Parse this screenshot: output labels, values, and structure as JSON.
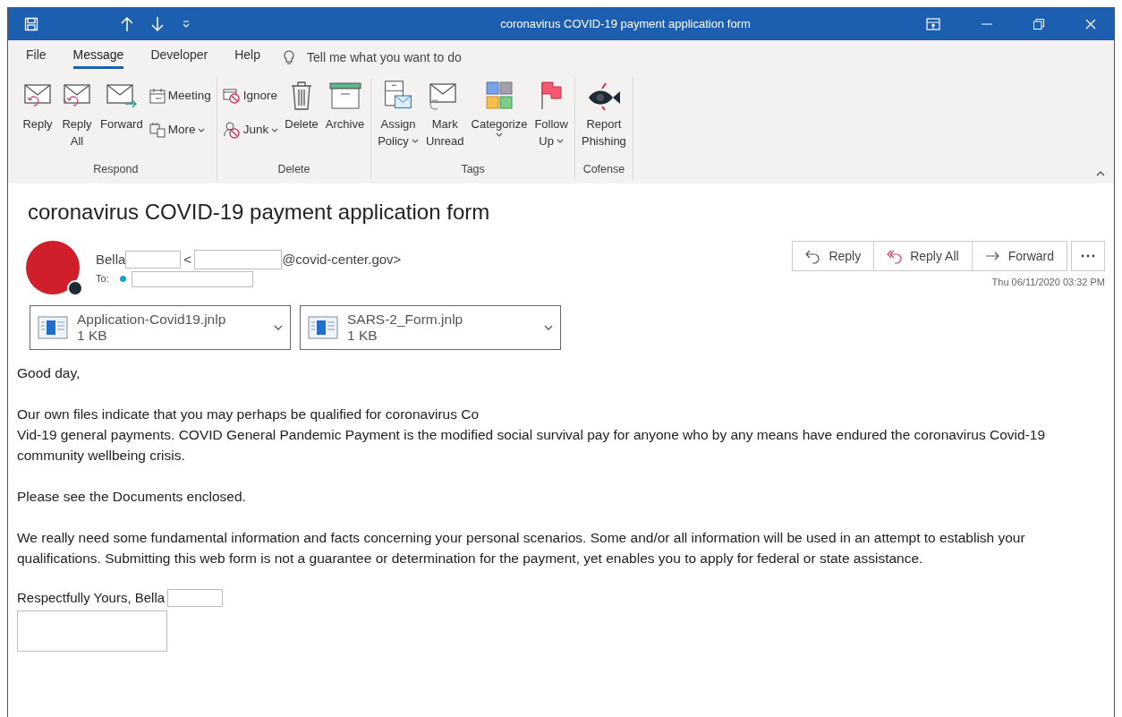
{
  "window": {
    "title": "coronavirus COVID-19 payment application form"
  },
  "menu_tabs": [
    {
      "label": "File",
      "selected": false
    },
    {
      "label": "Message",
      "selected": true
    },
    {
      "label": "Developer",
      "selected": false
    },
    {
      "label": "Help",
      "selected": false
    }
  ],
  "tell_me": {
    "placeholder": "Tell me what you want to do"
  },
  "ribbon": {
    "groups": [
      {
        "label": "Respond",
        "buttons": [
          {
            "kind": "large",
            "lines": [
              "Reply"
            ]
          },
          {
            "kind": "large",
            "lines": [
              "Reply",
              "All"
            ]
          },
          {
            "kind": "large",
            "lines": [
              "Forward"
            ]
          },
          {
            "kind": "small",
            "lines": [
              "Meeting"
            ]
          },
          {
            "kind": "small",
            "lines": [
              "More"
            ],
            "dropdown": true
          }
        ]
      },
      {
        "label": "Delete",
        "buttons": [
          {
            "kind": "small",
            "lines": [
              "Ignore"
            ]
          },
          {
            "kind": "small",
            "lines": [
              "Junk"
            ],
            "dropdown": true
          },
          {
            "kind": "large",
            "lines": [
              "Delete"
            ]
          },
          {
            "kind": "large",
            "lines": [
              "Archive"
            ]
          }
        ]
      },
      {
        "label": "Tags",
        "buttons": [
          {
            "kind": "large",
            "lines": [
              "Assign",
              "Policy"
            ],
            "dropdown": true
          },
          {
            "kind": "large",
            "lines": [
              "Mark",
              "Unread"
            ]
          },
          {
            "kind": "large",
            "lines": [
              "Categorize"
            ],
            "dropdown": true
          },
          {
            "kind": "large",
            "lines": [
              "Follow",
              "Up"
            ],
            "dropdown": true
          }
        ]
      },
      {
        "label": "Cofense",
        "buttons": [
          {
            "kind": "large",
            "lines": [
              "Report",
              "Phishing"
            ]
          }
        ]
      }
    ]
  },
  "message": {
    "subject": "coronavirus COVID-19 payment application form",
    "sender_name": "Bella",
    "sender_open": "<",
    "sender_domain": "@covid-center.gov>",
    "to_label": "To:",
    "actions": [
      "Reply",
      "Reply All",
      "Forward"
    ],
    "date": "Thu 06/11/2020 03:32 PM",
    "attachments": [
      {
        "name": "Application-Covid19.jnlp",
        "size": "1 KB"
      },
      {
        "name": "SARS-2_Form.jnlp",
        "size": "1 KB"
      }
    ],
    "paragraphs": [
      "Good day,",
      "Our own files indicate that you may perhaps be qualified for coronavirus Co\nVid-19 general payments. COVID General Pandemic Payment is the modified social survival pay for anyone who by any means have endured the coronavirus Covid-19 community wellbeing crisis.",
      "Please see the Documents enclosed.",
      "We really need some fundamental information and facts concerning your personal scenarios. Some and/or all information will be used in an attempt to establish your qualifications. Submitting this web form is not a guarantee or determination for the payment, yet enables you to apply for federal or state assistance."
    ],
    "signature": "Respectfully Yours, Bella"
  }
}
